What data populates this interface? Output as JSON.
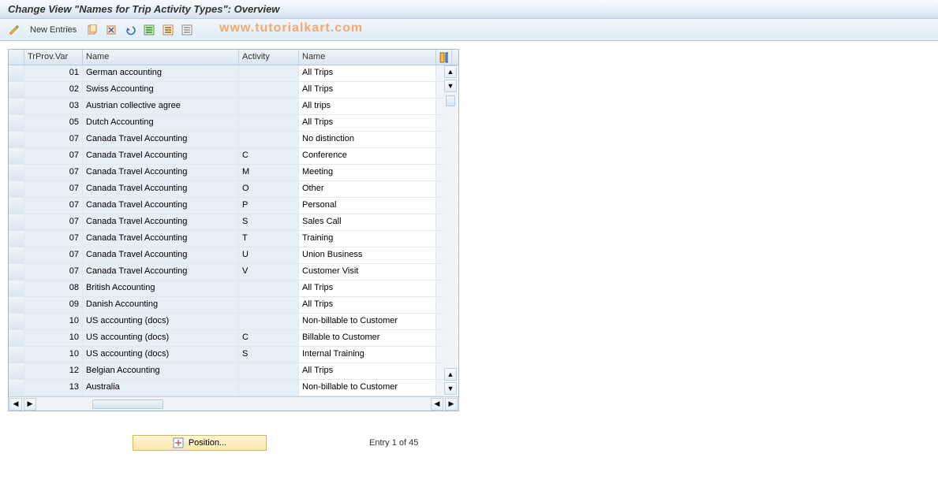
{
  "header": {
    "title": "Change View \"Names for Trip Activity Types\": Overview"
  },
  "toolbar": {
    "new_entries": "New Entries"
  },
  "watermark": "www.tutorialkart.com",
  "table": {
    "columns": {
      "trprov": "TrProv.Var",
      "name1": "Name",
      "activity": "Activity",
      "name2": "Name"
    },
    "rows": [
      {
        "trprov": "01",
        "name1": "German accounting",
        "activity": "",
        "name2": "All Trips"
      },
      {
        "trprov": "02",
        "name1": "Swiss Accounting",
        "activity": "",
        "name2": "All Trips"
      },
      {
        "trprov": "03",
        "name1": "Austrian collective agree",
        "activity": "",
        "name2": "All trips"
      },
      {
        "trprov": "05",
        "name1": "Dutch Accounting",
        "activity": "",
        "name2": "All Trips"
      },
      {
        "trprov": "07",
        "name1": "Canada Travel Accounting",
        "activity": "",
        "name2": "No distinction"
      },
      {
        "trprov": "07",
        "name1": "Canada Travel Accounting",
        "activity": "C",
        "name2": "Conference"
      },
      {
        "trprov": "07",
        "name1": "Canada Travel Accounting",
        "activity": "M",
        "name2": "Meeting"
      },
      {
        "trprov": "07",
        "name1": "Canada Travel Accounting",
        "activity": "O",
        "name2": "Other"
      },
      {
        "trprov": "07",
        "name1": "Canada Travel Accounting",
        "activity": "P",
        "name2": "Personal"
      },
      {
        "trprov": "07",
        "name1": "Canada Travel Accounting",
        "activity": "S",
        "name2": "Sales Call"
      },
      {
        "trprov": "07",
        "name1": "Canada Travel Accounting",
        "activity": "T",
        "name2": "Training"
      },
      {
        "trprov": "07",
        "name1": "Canada Travel Accounting",
        "activity": "U",
        "name2": "Union Business"
      },
      {
        "trprov": "07",
        "name1": "Canada Travel Accounting",
        "activity": "V",
        "name2": "Customer Visit"
      },
      {
        "trprov": "08",
        "name1": "British Accounting",
        "activity": "",
        "name2": "All Trips"
      },
      {
        "trprov": "09",
        "name1": "Danish Accounting",
        "activity": "",
        "name2": "All Trips"
      },
      {
        "trprov": "10",
        "name1": "US accounting (docs)",
        "activity": "",
        "name2": "Non-billable to Customer"
      },
      {
        "trprov": "10",
        "name1": "US accounting (docs)",
        "activity": "C",
        "name2": "Billable to Customer"
      },
      {
        "trprov": "10",
        "name1": "US accounting (docs)",
        "activity": "S",
        "name2": "Internal Training"
      },
      {
        "trprov": "12",
        "name1": "Belgian Accounting",
        "activity": "",
        "name2": "All Trips"
      },
      {
        "trprov": "13",
        "name1": "Australia",
        "activity": "",
        "name2": "Non-billable to Customer"
      }
    ]
  },
  "footer": {
    "position_label": "Position...",
    "entry_label": "Entry 1 of 45"
  }
}
